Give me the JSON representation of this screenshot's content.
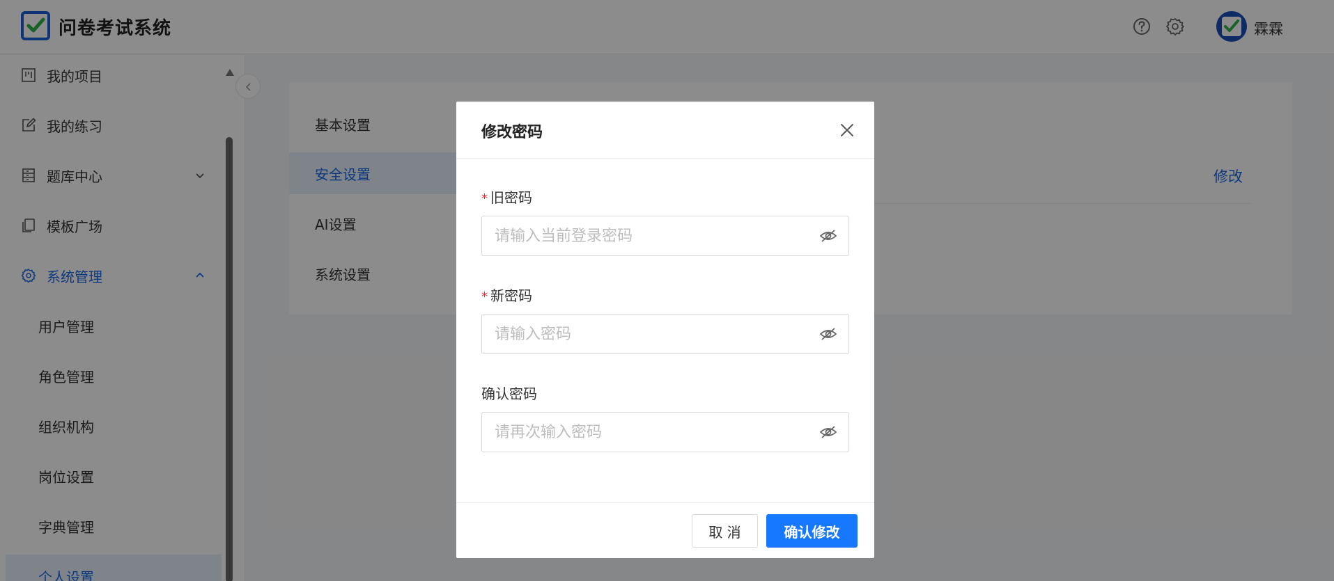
{
  "app": {
    "title": "问卷考试系统"
  },
  "header": {
    "username": "霖霖",
    "help_icon": "help-circle-icon",
    "settings_icon": "gear-icon"
  },
  "sidebar": {
    "items": [
      {
        "label": "我的项目",
        "icon": "project-icon"
      },
      {
        "label": "我的练习",
        "icon": "edit-icon"
      },
      {
        "label": "题库中心",
        "icon": "library-icon"
      },
      {
        "label": "模板广场",
        "icon": "template-icon"
      },
      {
        "label": "系统管理",
        "icon": "gear-icon"
      }
    ],
    "sub_items": [
      {
        "label": "用户管理"
      },
      {
        "label": "角色管理"
      },
      {
        "label": "组织机构"
      },
      {
        "label": "岗位设置"
      },
      {
        "label": "字典管理"
      },
      {
        "label": "个人设置"
      }
    ]
  },
  "settings": {
    "tabs": [
      {
        "label": "基本设置"
      },
      {
        "label": "安全设置"
      },
      {
        "label": "AI设置"
      },
      {
        "label": "系统设置"
      }
    ],
    "edit_label": "修改"
  },
  "modal": {
    "title": "修改密码",
    "required_mark": "*",
    "fields": [
      {
        "label": "旧密码",
        "placeholder": "请输入当前登录密码",
        "value": ""
      },
      {
        "label": "新密码",
        "placeholder": "请输入密码",
        "value": ""
      },
      {
        "label": "确认密码",
        "placeholder": "请再次输入密码",
        "value": ""
      }
    ],
    "cancel_label": "取 消",
    "confirm_label": "确认修改"
  },
  "colors": {
    "primary": "#1677ff",
    "accent_text": "#1a67e6",
    "required": "#f5222d",
    "brand": "#1d5fd8"
  }
}
